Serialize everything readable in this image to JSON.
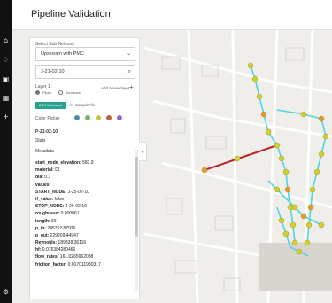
{
  "header": {
    "title": "Pipeline Validation"
  },
  "rail": {
    "icons": [
      "home-icon",
      "bell-icon",
      "box-icon",
      "grid-icon",
      "plus-icon",
      "settings-icon"
    ],
    "glyphs": [
      "⌂",
      "♢",
      "▣",
      "▦",
      "+",
      "⚙"
    ]
  },
  "panel": {
    "subnetwork_label": "Select Sub Network",
    "subnetwork_value": "Upstream with PMC",
    "search_value": "J-21-02-10",
    "layer_label": "Layer 1",
    "add_layer_label": "Add a new layer",
    "add_layer_glyph": "+",
    "radio_pipes": "Pipes",
    "radio_junctions": "Junctions",
    "csv_button": "CSV Uploaded",
    "sample_file": "SampleFile",
    "color_picker_label": "Color Picker",
    "color_options": [
      "#4a90a4",
      "#6fb86a",
      "#c8c83a",
      "#c0623f",
      "#9a64d0"
    ],
    "selected_id": "P-21-02-10",
    "stats_label": "Stats",
    "metadata_label": "Metadata",
    "metadata": [
      {
        "key": "start_node_elevation:",
        "value": " 583.9"
      },
      {
        "key": "material:",
        "value": " DI"
      },
      {
        "key": "dia:",
        "value": " 0.3"
      },
      {
        "key": "values:",
        "value": ""
      },
      {
        "key": "START_NODE:",
        "value": " J-25-02-10"
      },
      {
        "key": "if_value:",
        "value": " false"
      },
      {
        "key": "STOP_NODE:",
        "value": " J-26-02-10"
      },
      {
        "key": "roughness:",
        "value": " 0.000061"
      },
      {
        "key": "length:",
        "value": " 66"
      },
      {
        "key": "p_in:",
        "value": " 245752.87926"
      },
      {
        "key": "p_out:",
        "value": " 229209.44947"
      },
      {
        "key": "Reynolds:",
        "value": " 189838.36116"
      },
      {
        "key": "hf:",
        "value": " 0.076384280466"
      },
      {
        "key": "flow_rates:",
        "value": " 161.0265962088"
      },
      {
        "key": "friction_factor:",
        "value": " 0.017011980317"
      }
    ]
  },
  "map": {
    "pipe_color": "#4fd6e0",
    "node_color": "#d4cf2c",
    "node_alt_color": "#e59a2a",
    "selected_pipe_color": "#b8242a"
  }
}
